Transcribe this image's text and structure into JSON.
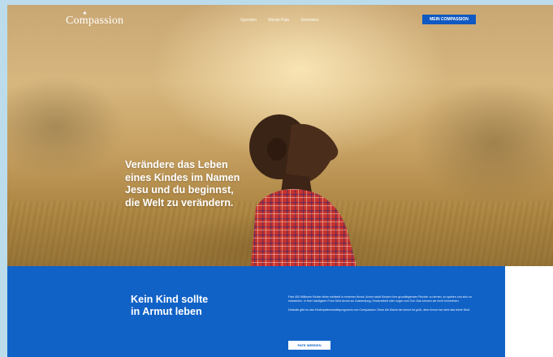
{
  "header": {
    "brand": "Compassion",
    "nav": [
      "Spenden",
      "Werde Pate",
      "Schenken"
    ],
    "cta": "MEIN COMPASSION"
  },
  "hero": {
    "headline_lines": [
      "Verändere das Leben",
      "eines Kindes im Namen",
      "Jesu und du beginnst,",
      "die Welt zu verändern."
    ]
  },
  "section": {
    "title_lines": [
      "Kein Kind sollte",
      "in Armut leben"
    ],
    "paragraph1": "Fast 400 Millionen Kinder leben weltweit in extremer Armut. Armut raubt Kindern ihre grundlegenden Rechte: zu lernen, zu spielen und sich zu entwickeln. In ihrer häufigsten Form führt Armut zur Ausbeutung, Kinderarbeit oder sogar zum Tod. Das können wir nicht hinnehmen.",
    "paragraph2": "Deshalb gibt es das Kinderpatenschaftsprogramm von Compassion: Denn die Macht der Armut ist groß, aber Armut hat nicht das letzte Wort.",
    "button": "PATE WERDEN"
  },
  "colors": {
    "accent": "#1162c7",
    "button_blue": "#1059c2",
    "outer_bg": "#bcdceb"
  }
}
